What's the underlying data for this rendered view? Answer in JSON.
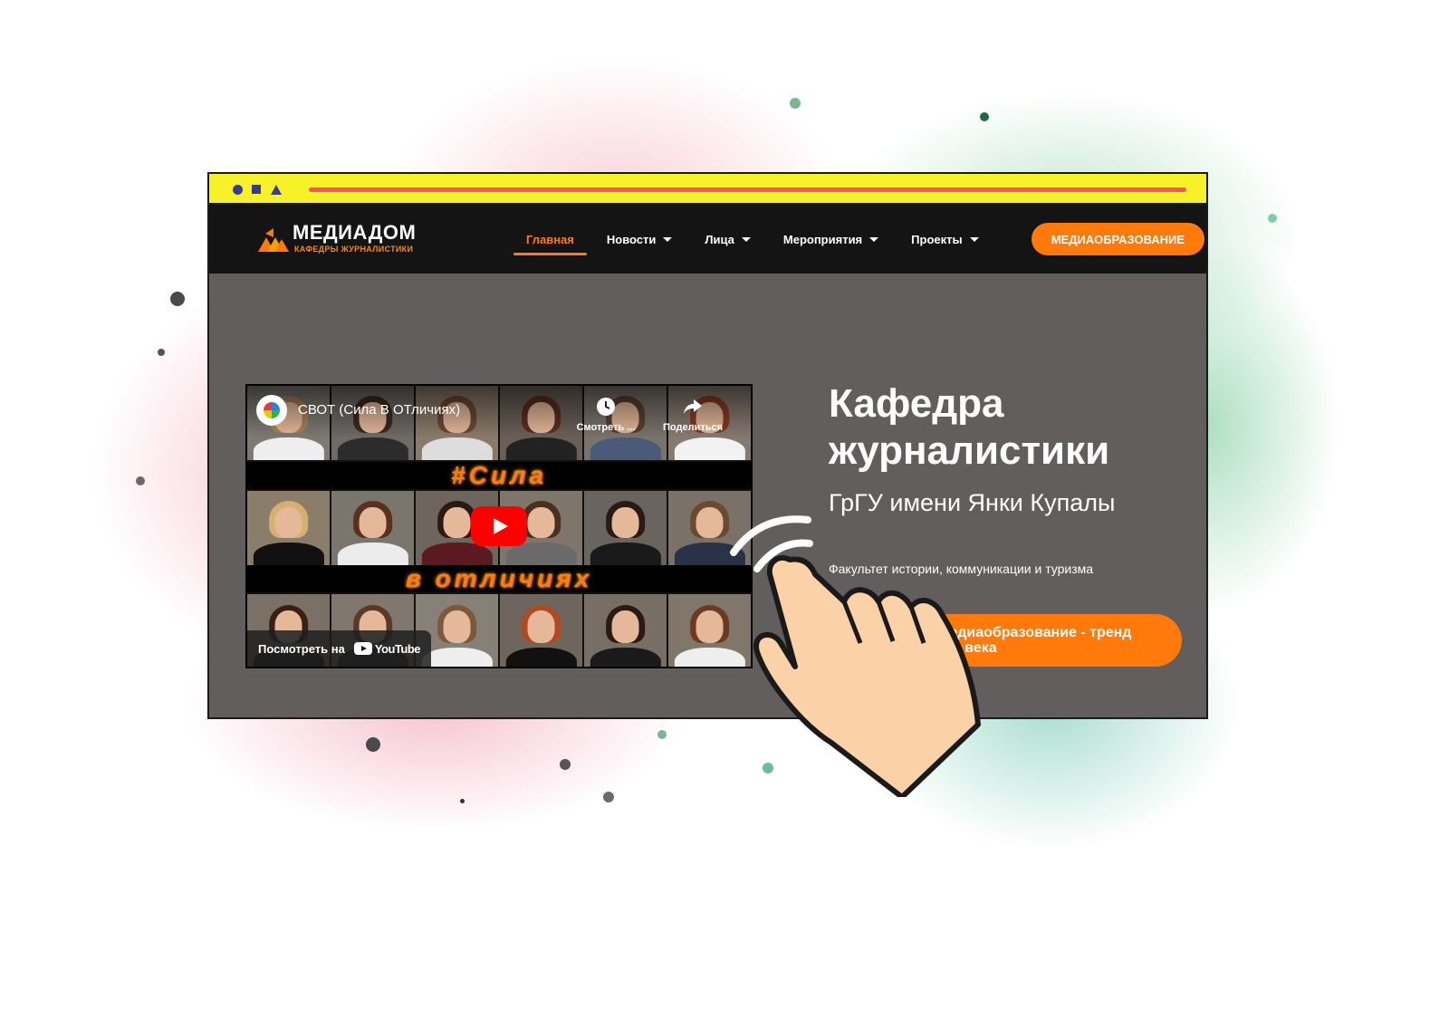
{
  "site": {
    "logo": {
      "title": "МЕДИАДОМ",
      "subtitle": "КАФЕДРЫ ЖУРНАЛИСТИКИ"
    },
    "nav": [
      {
        "label": "Главная",
        "active": true,
        "dropdown": false
      },
      {
        "label": "Новости",
        "active": false,
        "dropdown": true
      },
      {
        "label": "Лица",
        "active": false,
        "dropdown": true
      },
      {
        "label": "Мероприятия",
        "active": false,
        "dropdown": true
      },
      {
        "label": "Проекты",
        "active": false,
        "dropdown": true
      }
    ],
    "header_button": "МЕДИАОБРАЗОВАНИЕ"
  },
  "video": {
    "title": "СВОТ (Сила В ОТличиях)",
    "banner_top": "#Сила",
    "banner_bottom": "в отличиях",
    "watch_later": "Смотреть ...",
    "share": "Поделиться",
    "watch_on": "Посмотреть на",
    "platform": "YouTube"
  },
  "hero": {
    "title_line1": "Кафедра",
    "title_line2": "журналистики",
    "subtitle": "ГрГУ имени Янки Купалы",
    "faculty": "Факультет истории, коммуникации и туризма",
    "cta_line1": "Медиаобразование - тренд",
    "cta_line2": "XXI века"
  },
  "colors": {
    "accent": "#ff7a0a",
    "header_bg": "#141414",
    "hero_bg": "#625e5d",
    "chrome_bar": "#f7f12a",
    "chrome_line": "#ff4f6a"
  },
  "icons": [
    "clock-icon",
    "share-icon",
    "play-icon",
    "youtube-icon",
    "caret-down-icon",
    "pointing-hand-icon"
  ]
}
